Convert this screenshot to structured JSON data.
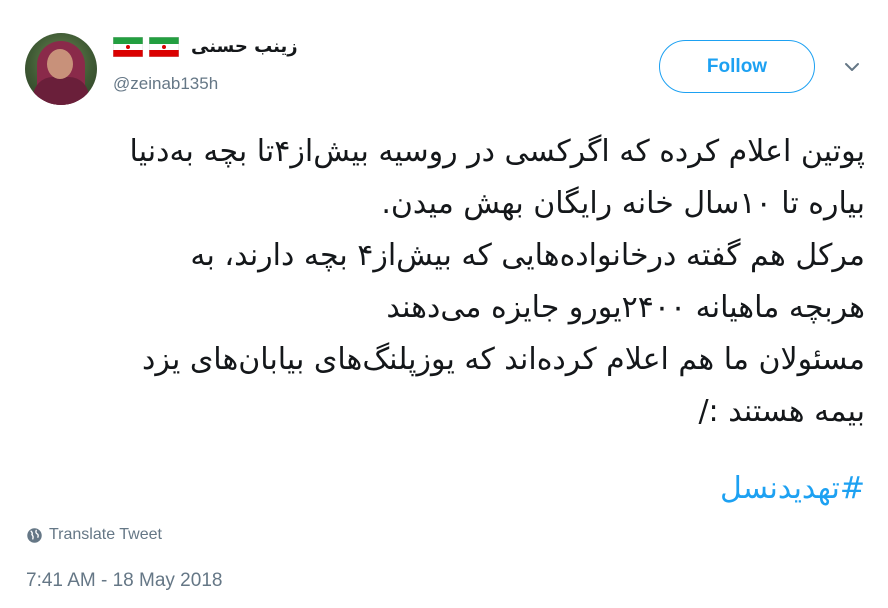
{
  "author": {
    "display_name": "زینب حسنی",
    "handle": "@zeinab135h",
    "flag_icon": "iran-flag-icon"
  },
  "follow_label": "Follow",
  "menu_icon": "chevron-down-icon",
  "tweet": {
    "text": "پوتین اعلام کرده که اگرکسی در روسیه بیش‌از۴تا بچه به‌دنیا\nبیاره تا ۱۰سال خانه رایگان بهش میدن.\nمرکل هم گفته درخانواده‌هایی که بیش‌از۴ بچه دارند، به\nهربچه ماهیانه ۲۴۰۰یورو جایزه می‌دهند\nمسئولان ما هم اعلام کرده‌اند که یوزپلنگ‌های بیابان‌های یزد\nبیمه هستند :/",
    "hashtag": "#تهدیدنسل"
  },
  "translate_label": "Translate Tweet",
  "timestamp": "7:41 AM - 18 May 2018",
  "colors": {
    "accent": "#1da1f2",
    "muted": "#657786",
    "text": "#14171a"
  }
}
